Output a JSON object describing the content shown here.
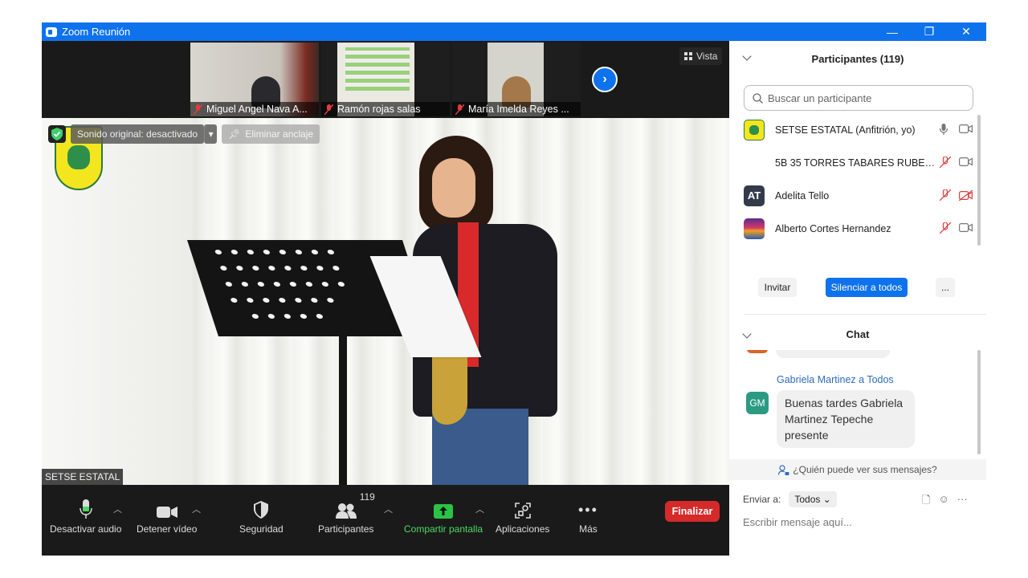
{
  "window": {
    "title": "Zoom Reunión",
    "min": "—",
    "restore": "❐",
    "close": "✕"
  },
  "thumbnails": [
    {
      "name": "Miguel Angel Nava A..."
    },
    {
      "name": "Ramón rojas salas"
    },
    {
      "name": "María Imelda Reyes ..."
    }
  ],
  "view_button": "Vista",
  "video": {
    "original_sound": "Sonido original: desactivado",
    "unpin": "Eliminar anclaje",
    "speaker_name": "SETSE ESTATAL"
  },
  "toolbar": {
    "audio": "Desactivar audio",
    "video": "Detener vídeo",
    "security": "Seguridad",
    "participants": "Participantes",
    "participants_count": "119",
    "share": "Compartir pantalla",
    "apps": "Aplicaciones",
    "more": "Más",
    "end": "Finalizar"
  },
  "participants": {
    "title": "Participantes (119)",
    "search_placeholder": "Buscar un participante",
    "items": [
      {
        "name": "SETSE ESTATAL (Anfitrión, yo)",
        "initials": "",
        "mic": "on",
        "cam": "on"
      },
      {
        "name": "5B 35 TORRES TABARES RUBEN ...",
        "initials": "",
        "mic": "off",
        "cam": "on"
      },
      {
        "name": "Adelita Tello",
        "initials": "AT",
        "mic": "off",
        "cam": "off"
      },
      {
        "name": "Alberto Cortes Hernandez",
        "initials": "",
        "mic": "off",
        "cam": "on"
      }
    ],
    "invite": "Invitar",
    "mute_all": "Silenciar a todos",
    "more": "..."
  },
  "chat": {
    "title": "Chat",
    "sender": "Gabriela Martinez a Todos",
    "sender_initials": "GM",
    "message": "Buenas tardes Gabriela Martinez Tepeche presente",
    "visibility": "¿Quién puede ver sus mensajes?",
    "send_to_label": "Enviar a:",
    "send_to_value": "Todos",
    "placeholder": "Escribir mensaje aquí..."
  },
  "colors": {
    "accent": "#0e72ed",
    "end": "#d42a2a",
    "share": "#4cd964"
  }
}
